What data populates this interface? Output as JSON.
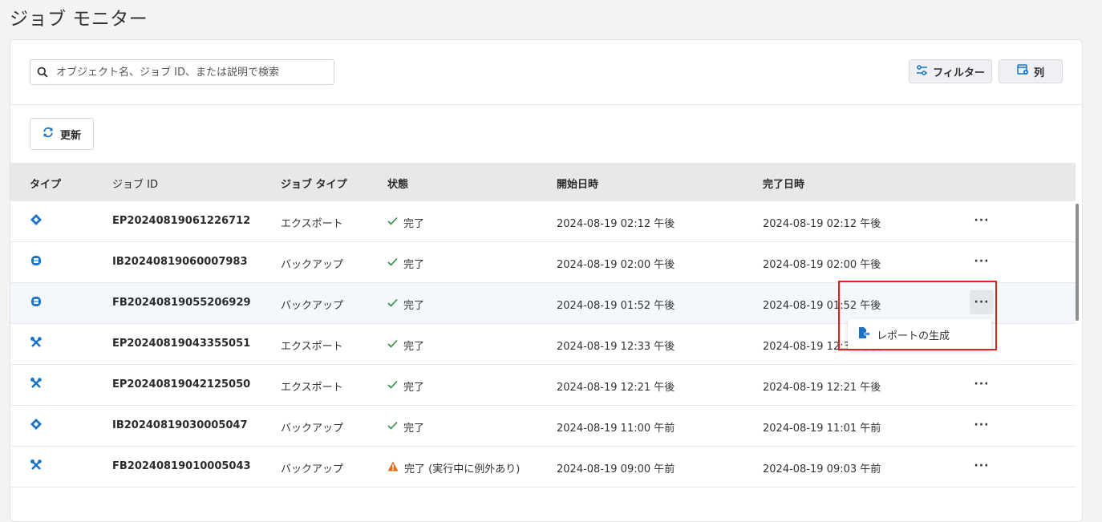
{
  "page": {
    "title": "ジョブ モニター"
  },
  "toolbar": {
    "search_placeholder": "オブジェクト名、ジョブ ID、または説明で検索",
    "filter_label": "フィルター",
    "columns_label": "列",
    "refresh_label": "更新"
  },
  "table": {
    "headers": {
      "type": "タイプ",
      "job_id": "ジョブ ID",
      "job_type": "ジョブ タイプ",
      "status": "状態",
      "start": "開始日時",
      "end": "完了日時"
    },
    "rows": [
      {
        "icon": "diamond-export-icon",
        "job_id": "EP20240819061226712",
        "job_type": "エクスポート",
        "status": "完了",
        "status_icon": "check-icon",
        "start": "2024-08-19 02:12 午後",
        "end": "2024-08-19 02:12 午後",
        "more": "···"
      },
      {
        "icon": "database-icon",
        "job_id": "IB20240819060007983",
        "job_type": "バックアップ",
        "status": "完了",
        "status_icon": "check-icon",
        "start": "2024-08-19 02:00 午後",
        "end": "2024-08-19 02:00 午後",
        "more": "···"
      },
      {
        "icon": "database-icon",
        "job_id": "FB20240819055206929",
        "job_type": "バックアップ",
        "status": "完了",
        "status_icon": "check-icon",
        "start": "2024-08-19 01:52 午後",
        "end": "2024-08-19 01:52 午後",
        "more": "···"
      },
      {
        "icon": "tools-icon",
        "job_id": "EP20240819043355051",
        "job_type": "エクスポート",
        "status": "完了",
        "status_icon": "check-icon",
        "start": "2024-08-19 12:33 午後",
        "end": "2024-08-19 12:34 午後",
        "more": "···"
      },
      {
        "icon": "tools-icon",
        "job_id": "EP20240819042125050",
        "job_type": "エクスポート",
        "status": "完了",
        "status_icon": "check-icon",
        "start": "2024-08-19 12:21 午後",
        "end": "2024-08-19 12:21 午後",
        "more": "···"
      },
      {
        "icon": "diamond-export-icon",
        "job_id": "IB20240819030005047",
        "job_type": "バックアップ",
        "status": "完了",
        "status_icon": "check-icon",
        "start": "2024-08-19 11:00 午前",
        "end": "2024-08-19 11:01 午前",
        "more": "···"
      },
      {
        "icon": "tools-icon",
        "job_id": "FB20240819010005043",
        "job_type": "バックアップ",
        "status": "完了 (実行中に例外あり)",
        "status_icon": "warning-icon",
        "start": "2024-08-19 09:00 午前",
        "end": "2024-08-19 09:03 午前",
        "more": "···"
      }
    ]
  },
  "context_menu": {
    "item_label": "レポートの生成",
    "item_icon": "report-export-icon"
  },
  "colors": {
    "accent": "#1a73c8",
    "success": "#2e8b3e",
    "warning": "#e0701a",
    "highlight": "#e0201a"
  }
}
